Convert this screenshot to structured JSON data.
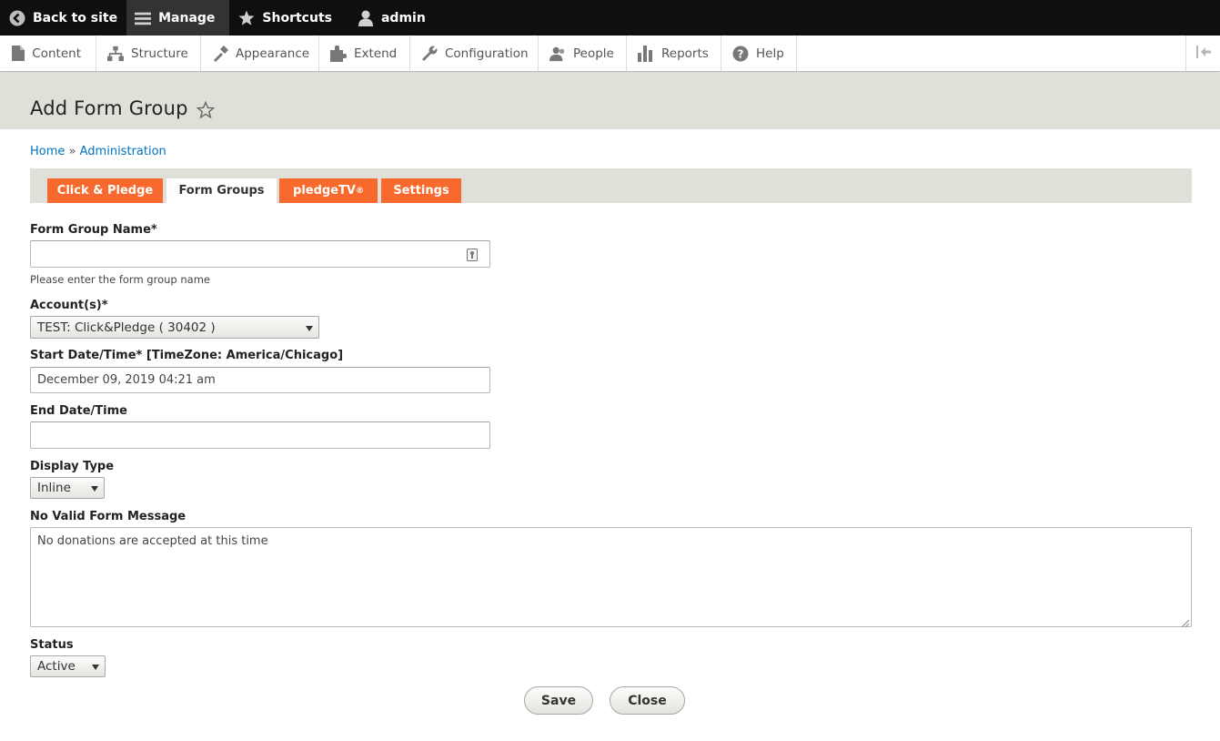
{
  "toolbar": {
    "back_to_site": "Back to site",
    "manage": "Manage",
    "shortcuts": "Shortcuts",
    "user": "admin"
  },
  "tray": {
    "items": [
      "Content",
      "Structure",
      "Appearance",
      "Extend",
      "Configuration",
      "People",
      "Reports",
      "Help"
    ]
  },
  "page": {
    "title": "Add Form Group"
  },
  "breadcrumb": {
    "home": "Home",
    "separator": "»",
    "administration": "Administration"
  },
  "tabs": {
    "click_pledge": "Click & Pledge",
    "form_groups": "Form Groups",
    "pledgetv": "pledgeTV",
    "pledgetv_mark": "®",
    "settings": "Settings"
  },
  "form": {
    "name_label": "Form Group Name*",
    "name_value": "",
    "name_hint": "Please enter the form group name",
    "accounts_label": "Account(s)*",
    "accounts_value": "TEST: Click&Pledge ( 30402 )",
    "start_label": "Start Date/Time* [TimeZone: America/Chicago]",
    "start_value": "December 09, 2019 04:21 am",
    "end_label": "End Date/Time",
    "end_value": "",
    "display_label": "Display Type",
    "display_value": "Inline",
    "message_label": "No Valid Form Message",
    "message_value": "No donations are accepted at this time",
    "status_label": "Status",
    "status_value": "Active"
  },
  "buttons": {
    "save": "Save",
    "close": "Close"
  },
  "colors": {
    "toolbar_bg": "#0f0f0f",
    "accent_tab": "#f7692c",
    "link": "#0074bd",
    "header_bg": "#e0e0d8"
  }
}
